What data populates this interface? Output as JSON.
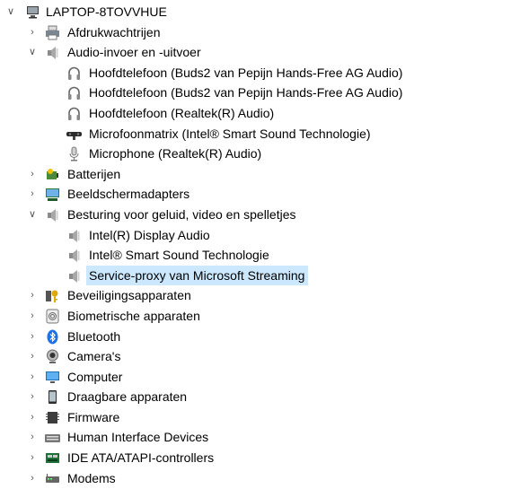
{
  "tree": {
    "root": "LAPTOP-8TOVVHUE",
    "categories": [
      {
        "label": "Afdrukwachtrijen",
        "icon": "printer-icon"
      },
      {
        "label": "Audio-invoer en -uitvoer",
        "icon": "speaker-icon",
        "expanded": true,
        "children": [
          {
            "label": "Hoofdtelefoon (Buds2 van Pepijn Hands-Free AG Audio)",
            "icon": "headphones-icon"
          },
          {
            "label": "Hoofdtelefoon (Buds2 van Pepijn Hands-Free AG Audio)",
            "icon": "headphones-icon"
          },
          {
            "label": "Hoofdtelefoon (Realtek(R) Audio)",
            "icon": "headphones-icon"
          },
          {
            "label": "Microfoonmatrix (Intel® Smart Sound Technologie)",
            "icon": "microphone-array-icon"
          },
          {
            "label": "Microphone (Realtek(R) Audio)",
            "icon": "microphone-icon"
          }
        ]
      },
      {
        "label": "Batterijen",
        "icon": "battery-icon"
      },
      {
        "label": "Beeldschermadapters",
        "icon": "display-adapter-icon"
      },
      {
        "label": "Besturing voor geluid, video en spelletjes",
        "icon": "speaker-icon",
        "expanded": true,
        "children": [
          {
            "label": "Intel(R) Display Audio",
            "icon": "speaker-icon"
          },
          {
            "label": "Intel® Smart Sound Technologie",
            "icon": "speaker-icon"
          },
          {
            "label": "Service-proxy van Microsoft Streaming",
            "icon": "speaker-icon",
            "selected": true
          }
        ]
      },
      {
        "label": "Beveiligingsapparaten",
        "icon": "security-key-icon"
      },
      {
        "label": "Biometrische apparaten",
        "icon": "fingerprint-icon"
      },
      {
        "label": "Bluetooth",
        "icon": "bluetooth-icon"
      },
      {
        "label": "Camera's",
        "icon": "camera-icon"
      },
      {
        "label": "Computer",
        "icon": "monitor-icon"
      },
      {
        "label": "Draagbare apparaten",
        "icon": "portable-device-icon"
      },
      {
        "label": "Firmware",
        "icon": "firmware-icon"
      },
      {
        "label": "Human Interface Devices",
        "icon": "keyboard-icon"
      },
      {
        "label": "IDE ATA/ATAPI-controllers",
        "icon": "ide-controller-icon"
      },
      {
        "label": "Modems",
        "icon": "modem-icon"
      }
    ]
  },
  "colors": {
    "selection": "#cce8ff",
    "bluetooth": "#1a73e8"
  }
}
